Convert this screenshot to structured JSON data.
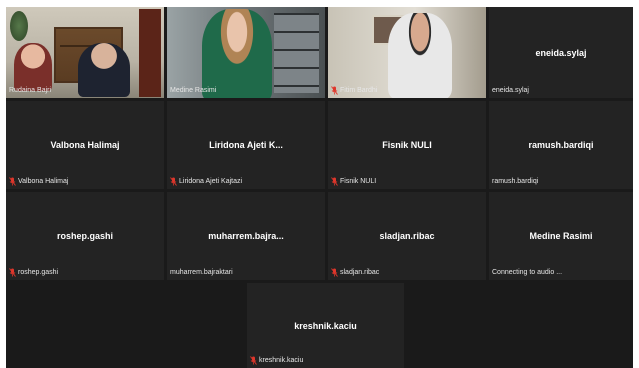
{
  "participants": [
    {
      "center_name": "",
      "label": "Rudaina Bajri",
      "muted": false,
      "video": "v1"
    },
    {
      "center_name": "",
      "label": "Medine Rasimi",
      "muted": false,
      "video": "v2"
    },
    {
      "center_name": "",
      "label": "Fitim Bardhi",
      "muted": true,
      "video": "v3"
    },
    {
      "center_name": "eneida.sylaj",
      "label": "eneida.sylaj",
      "muted": false
    },
    {
      "center_name": "Valbona Halimaj",
      "label": "Valbona Halimaj",
      "muted": true
    },
    {
      "center_name": "Liridona Ajeti K...",
      "label": "Liridona Ajeti Kajtazi",
      "muted": true
    },
    {
      "center_name": "Fisnik NULI",
      "label": "Fisnik NULI",
      "muted": true
    },
    {
      "center_name": "ramush.bardiqi",
      "label": "ramush.bardiqi",
      "muted": false
    },
    {
      "center_name": "roshep.gashi",
      "label": "roshep.gashi",
      "muted": true
    },
    {
      "center_name": "muharrem.bajra...",
      "label": "muharrem.bajraktari",
      "muted": false
    },
    {
      "center_name": "sladjan.ribac",
      "label": "sladjan.ribac",
      "muted": true
    },
    {
      "center_name": "Medine Rasimi",
      "label": "Connecting to audio ...",
      "muted": false
    },
    {
      "center_name": "kreshnik.kaciu",
      "label": "kreshnik.kaciu",
      "muted": true
    }
  ],
  "colors": {
    "active_speaker_border": "#e7e11a",
    "muted_icon": "#e0362b",
    "tile_bg": "#232323"
  }
}
